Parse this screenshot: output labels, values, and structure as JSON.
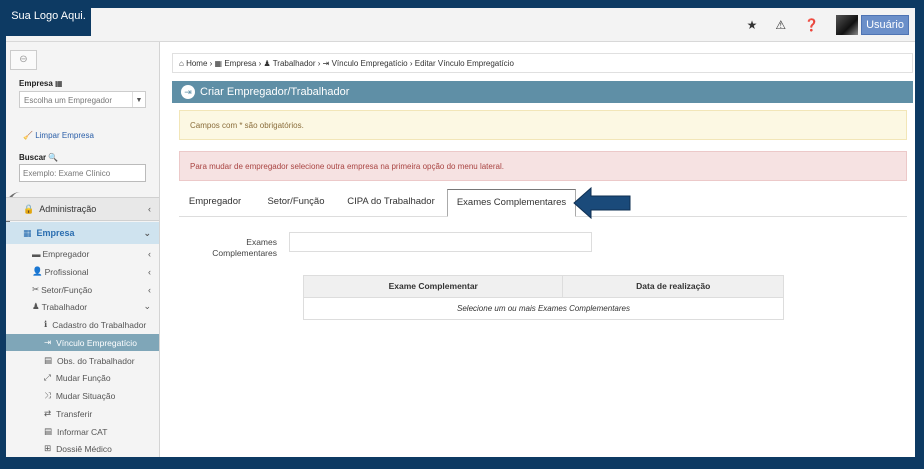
{
  "header": {
    "logo_text": "Sua Logo Aqui.",
    "icons": [
      "star-icon",
      "warning-icon",
      "help-icon"
    ],
    "user_label": "Usuário"
  },
  "sidebar": {
    "collapse_icon": "arrow-left-circle-icon",
    "empresa_label": "Empresa",
    "empresa_select": "Escolha um Empregador",
    "clear_label": "Limpar Empresa",
    "search_label": "Buscar",
    "search_placeholder": "Exemplo: Exame Clínico",
    "menu": [
      {
        "label": "Administração"
      },
      {
        "label": "Empresa"
      }
    ],
    "submenu": [
      {
        "label": "Empregador"
      },
      {
        "label": "Profissional"
      },
      {
        "label": "Setor/Função"
      },
      {
        "label": "Trabalhador"
      }
    ],
    "trabalhador_items": [
      {
        "label": "Cadastro do Trabalhador"
      },
      {
        "label": "Vínculo Empregatício"
      },
      {
        "label": "Obs. do Trabalhador"
      },
      {
        "label": "Mudar Função"
      },
      {
        "label": "Mudar Situação"
      },
      {
        "label": "Transferir"
      },
      {
        "label": "Informar CAT"
      },
      {
        "label": "Dossiê Médico"
      }
    ]
  },
  "breadcrumb": {
    "home": "Home",
    "empresa": "Empresa",
    "trabalhador": "Trabalhador",
    "vinculo": "Vínculo Empregatício",
    "current": "Editar Vínculo Empregatício"
  },
  "panel": {
    "title": "Criar Empregador/Trabalhador",
    "warning": "Campos com * são obrigatórios.",
    "danger": "Para mudar de empregador selecione outra empresa na primeira opção do menu lateral."
  },
  "tabs": [
    {
      "label": "Empregador"
    },
    {
      "label": "Setor/Função"
    },
    {
      "label": "CIPA do Trabalhador"
    },
    {
      "label": "Exames Complementares"
    }
  ],
  "form": {
    "exames_label_line1": "Exames",
    "exames_label_line2": "Complementares",
    "exames_value": ""
  },
  "table": {
    "columns": [
      "Exame Complementar",
      "Data de realização"
    ],
    "empty_text": "Selecione um ou mais Exames Complementares"
  },
  "colors": {
    "frame": "#0d3a63",
    "panel_header": "#5f8fa6",
    "active_menu": "#7fa6b8",
    "arrow": "#1a4a7a"
  }
}
